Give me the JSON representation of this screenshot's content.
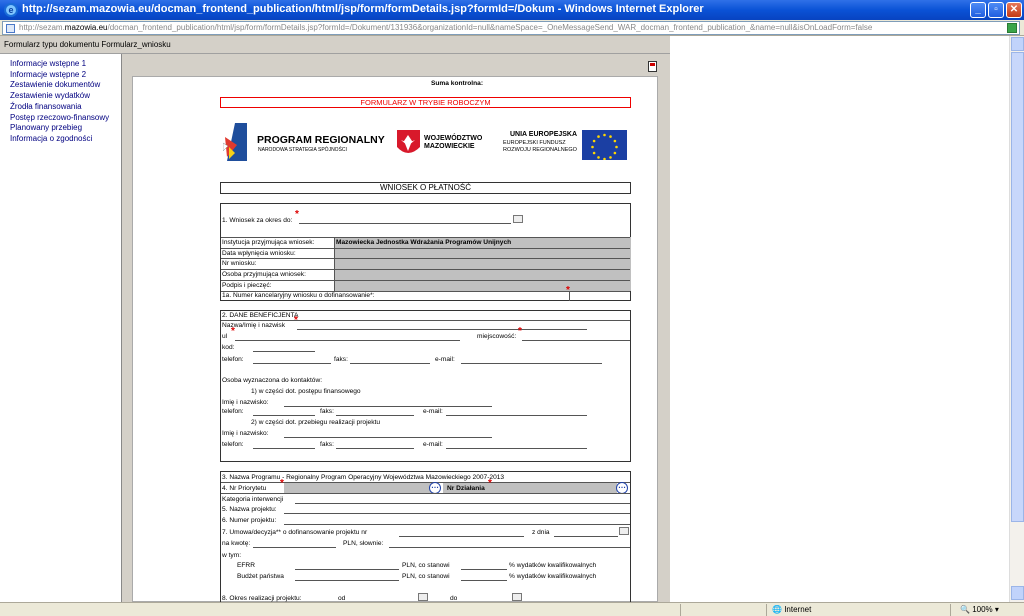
{
  "window": {
    "title": "http://sezam.mazowia.eu/docman_frontend_publication/html/jsp/form/formDetails.jsp?formId=/Dokum - Windows Internet Explorer",
    "address_pre": "http://sezam.",
    "address_host": "mazowia.eu",
    "address_post": "/docman_frontend_publication/html/jsp/form/formDetails.jsp?formId=/Dokument/131936&organizationId=null&nameSpace=_OneMessageSend_WAR_docman_frontend_publication_&name=null&isOnLoadForm=false"
  },
  "form_header": "Formularz typu dokumentu Formularz_wniosku",
  "nav": [
    "Informacje wstępne 1",
    "Informacje wstępne 2",
    "Zestawienie dokumentów",
    "Zestawienie wydatków",
    "Źrodła finansowania",
    "Postęp rzeczowo-finansowy",
    "Planowany przebieg",
    "Informacja o zgodności"
  ],
  "sheet": {
    "checksum": "Suma kontrolna:",
    "draft": "FORMULARZ W TRYBIE ROBOCZYM",
    "logo1_main": "PROGRAM REGIONALNY",
    "logo1_sub": "NARODOWA STRATEGIA SPÓJNOŚCI",
    "logo2_line1": "WOJEWÓDZTWO",
    "logo2_line2": "MAZOWIECKIE",
    "logo3_line1": "UNIA EUROPEJSKA",
    "logo3_line2": "EUROPEJSKI FUNDUSZ",
    "logo3_line3": "ROZWOJU REGIONALNEGO",
    "title": "WNIOSEK O PŁATNOŚĆ",
    "s1_period": "1. Wniosek za okres do:",
    "rows": [
      "Instytucja przyjmująca wniosek:",
      "Data wpłynięcia wniosku:",
      "Nr wniosku:",
      "Osoba przyjmująca wniosek:",
      "Podpis i pieczęć:"
    ],
    "institution": "Mazowiecka Jednostka Wdrażania Programów Unijnych",
    "s1a": "1a. Numer kancelaryjny wniosku o dofinansowanie*:",
    "s2_title": "2. DANE BENEFICJENTA",
    "s2_name": "Nazwa/Imię i nazwisk",
    "s2_ul": "ul",
    "s2_city": "miejscowość:",
    "s2_kod": "kod:",
    "phone": "telefon:",
    "fax": "faks:",
    "email": "e-mail:",
    "contact": "Osoba  wyznaczona do kontaktów:",
    "c1": "1) w części dot. postępu finansowego",
    "c2": "2) w części dot. przebiegu realizacji projektu",
    "fullname": "Imię i nazwisko:",
    "s3": "3. Nazwa Programu - Regionalny Program Operacyjny Województwa Mazowieckiego 2007-2013",
    "s4": "4. Nr Priorytetu",
    "s4_action": "Nr Działania",
    "s4_cat": "Kategoria interwencji",
    "s5": "5. Nazwa projektu:",
    "s6": "6. Numer projektu:",
    "s7": "7.  Umowa/decyzja** o dofinansowanie projektu nr",
    "s7_date": "z dnia",
    "amount": "na kwotę:",
    "words": "PLN, słownie:",
    "incl": "w tym:",
    "efrr": "EFRR",
    "budget": "Budżet państwa",
    "pln_pct": "PLN, co stanowi",
    "pct_elig": "% wydatków kwalifikowalnych",
    "s8": "8. Okres realizacji projektu:",
    "s8_from": "od",
    "s8_to": "do"
  },
  "status": {
    "zone": "Internet",
    "zoom": "100%"
  }
}
